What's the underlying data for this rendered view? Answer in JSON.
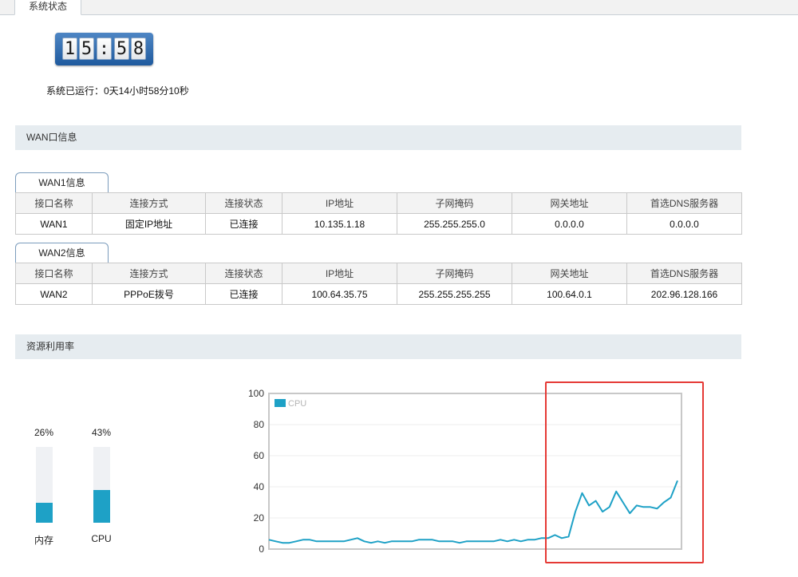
{
  "tabs": [
    {
      "label": "系统状态"
    }
  ],
  "clock": {
    "digits": [
      "1",
      "5",
      ":",
      "5",
      "8"
    ]
  },
  "uptime": {
    "text": "系统已运行：0天14小时58分10秒"
  },
  "sections": {
    "wan": "WAN口信息",
    "resources": "资源利用率"
  },
  "wan_table": {
    "columns": [
      "接口名称",
      "连接方式",
      "连接状态",
      "IP地址",
      "子网掩码",
      "网关地址",
      "首选DNS服务器"
    ]
  },
  "wan1": {
    "tab_label": "WAN1信息",
    "row": [
      "WAN1",
      "固定IP地址",
      "已连接",
      "10.135.1.18",
      "255.255.255.0",
      "0.0.0.0",
      "0.0.0.0"
    ]
  },
  "wan2": {
    "tab_label": "WAN2信息",
    "row": [
      "WAN2",
      "PPPoE拨号",
      "已连接",
      "100.64.35.75",
      "255.255.255.255",
      "100.64.0.1",
      "202.96.128.166"
    ]
  },
  "usage": {
    "memory": {
      "label": "内存",
      "percent_text": "26%",
      "value": 26
    },
    "cpu": {
      "label": "CPU",
      "percent_text": "43%",
      "value": 43
    }
  },
  "colors": {
    "accent": "#1ea1c6",
    "highlight": "#e53935",
    "section_bg": "#e6ecf0"
  },
  "chart_data": {
    "type": "line",
    "series": [
      {
        "name": "CPU",
        "values": [
          6,
          5,
          4,
          4,
          5,
          6,
          6,
          5,
          5,
          5,
          5,
          5,
          6,
          7,
          5,
          4,
          5,
          4,
          5,
          5,
          5,
          5,
          6,
          6,
          6,
          5,
          5,
          5,
          4,
          5,
          5,
          5,
          5,
          5,
          6,
          5,
          6,
          5,
          6,
          6,
          7,
          7,
          9,
          7,
          8,
          24,
          36,
          28,
          31,
          24,
          27,
          37,
          30,
          23,
          28,
          27,
          27,
          26,
          30,
          33,
          44
        ]
      }
    ],
    "ylim": [
      0,
      100
    ],
    "yticks": [
      0,
      20,
      40,
      60,
      80,
      100
    ],
    "grid": true,
    "legend": "top-left"
  }
}
